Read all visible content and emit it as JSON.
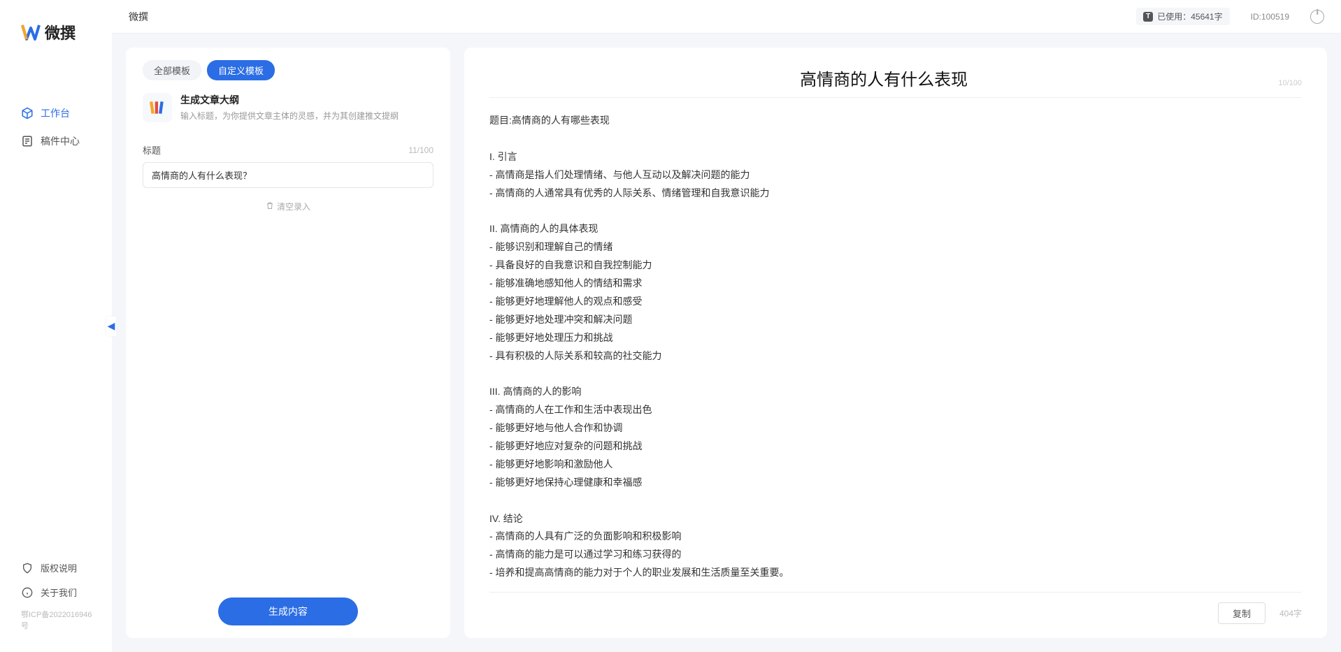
{
  "sidebar": {
    "logo_text": "微撰",
    "nav": [
      {
        "label": "工作台"
      },
      {
        "label": "稿件中心"
      }
    ],
    "footer": [
      {
        "label": "版权说明"
      },
      {
        "label": "关于我们"
      }
    ],
    "icp": "鄂ICP备2022016946号"
  },
  "header": {
    "title": "微撰",
    "usage_label": "已使用：45641字",
    "id_label": "ID:100519"
  },
  "left": {
    "tabs": [
      {
        "label": "全部模板"
      },
      {
        "label": "自定义模板"
      }
    ],
    "template": {
      "title": "生成文章大纲",
      "desc": "输入标题，为你提供文章主体的灵感，并为其创建推文提纲"
    },
    "field_label": "标题",
    "field_count": "11/100",
    "input_value": "高情商的人有什么表现？",
    "clear_label": "清空录入",
    "generate_label": "生成内容"
  },
  "right": {
    "title": "高情商的人有什么表现",
    "title_count": "10/100",
    "body": "题目:高情商的人有哪些表现\n\nI. 引言\n- 高情商是指人们处理情绪、与他人互动以及解决问题的能力\n- 高情商的人通常具有优秀的人际关系、情绪管理和自我意识能力\n\nII. 高情商的人的具体表现\n- 能够识别和理解自己的情绪\n- 具备良好的自我意识和自我控制能力\n- 能够准确地感知他人的情结和需求\n- 能够更好地理解他人的观点和感受\n- 能够更好地处理冲突和解决问题\n- 能够更好地处理压力和挑战\n- 具有积极的人际关系和较高的社交能力\n\nIII. 高情商的人的影响\n- 高情商的人在工作和生活中表现出色\n- 能够更好地与他人合作和协调\n- 能够更好地应对复杂的问题和挑战\n- 能够更好地影响和激励他人\n- 能够更好地保持心理健康和幸福感\n\nIV. 结论\n- 高情商的人具有广泛的负面影响和积极影响\n- 高情商的能力是可以通过学习和练习获得的\n- 培养和提高高情商的能力对于个人的职业发展和生活质量至关重要。",
    "copy_label": "复制",
    "word_count": "404字"
  }
}
